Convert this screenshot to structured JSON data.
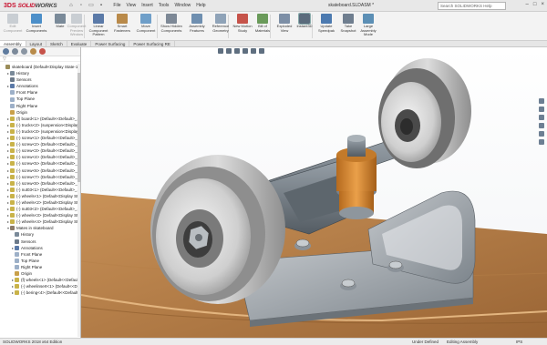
{
  "app": {
    "logo_prefix": "3DS",
    "logo_text_a": "SOLID",
    "logo_text_b": "WORKS",
    "document_title": "skateboard.SLDASM *",
    "search_placeholder": "Search SOLIDWORKS Help",
    "menu": [
      "File",
      "View",
      "Insert",
      "Tools",
      "Window",
      "Help"
    ]
  },
  "ribbon": {
    "buttons": [
      {
        "label": "Edit Component",
        "icon": "edit-component-icon",
        "dim": true
      },
      {
        "label": "Insert Components",
        "icon": "insert-components-icon"
      },
      {
        "label": "Mate",
        "icon": "mate-icon"
      },
      {
        "label": "Component Preview Window",
        "icon": "component-preview-icon",
        "dim": true
      },
      {
        "label": "Linear Component Pattern",
        "icon": "linear-pattern-icon"
      },
      {
        "label": "Smart Fasteners",
        "icon": "smart-fasteners-icon"
      },
      {
        "label": "Move Component",
        "icon": "move-component-icon"
      },
      {
        "label": "Show Hidden Components",
        "icon": "show-hidden-icon"
      },
      {
        "label": "Assembly Features",
        "icon": "assembly-features-icon"
      },
      {
        "label": "Reference Geometry",
        "icon": "reference-geometry-icon"
      },
      {
        "label": "New Motion Study",
        "icon": "motion-study-icon"
      },
      {
        "label": "Bill of Materials",
        "icon": "bom-icon"
      },
      {
        "label": "Exploded View",
        "icon": "exploded-view-icon"
      },
      {
        "label": "Instant3D",
        "icon": "instant3d-icon",
        "selected": true
      },
      {
        "label": "Update Speedpak",
        "icon": "speedpak-icon"
      },
      {
        "label": "Take Snapshot",
        "icon": "snapshot-icon"
      },
      {
        "label": "Large Assembly Mode",
        "icon": "large-assembly-icon"
      }
    ]
  },
  "tabs": [
    "Assembly",
    "Layout",
    "Sketch",
    "Evaluate",
    "Power Surfacing",
    "Power Surfacing RE"
  ],
  "tree": {
    "filter_icon": "filter-icon",
    "items": [
      {
        "label": "skateboard (Default<Display State-1>)",
        "indent": 0,
        "twisty": "",
        "icon": "#9b8d5a"
      },
      {
        "label": "History",
        "indent": 1,
        "twisty": "▸",
        "icon": "#7a8a99"
      },
      {
        "label": "Sensors",
        "indent": 1,
        "twisty": "",
        "icon": "#6c7a8a"
      },
      {
        "label": "Annotations",
        "indent": 1,
        "twisty": "▸",
        "icon": "#5b7aa8"
      },
      {
        "label": "Front Plane",
        "indent": 1,
        "twisty": "",
        "icon": "#9db0c8"
      },
      {
        "label": "Top Plane",
        "indent": 1,
        "twisty": "",
        "icon": "#9db0c8"
      },
      {
        "label": "Right Plane",
        "indent": 1,
        "twisty": "",
        "icon": "#9db0c8"
      },
      {
        "label": "Origin",
        "indent": 1,
        "twisty": "",
        "icon": "#c9a04a"
      },
      {
        "label": "(f) board<1> (Default<<Default>_...",
        "indent": 1,
        "twisty": "▸",
        "icon": "#c9b34a"
      },
      {
        "label": "(-) trucks<2> (suspension<Display...",
        "indent": 1,
        "twisty": "▸",
        "icon": "#c9b34a"
      },
      {
        "label": "(-) trucks<3> (suspension<Display...",
        "indent": 1,
        "twisty": "▸",
        "icon": "#c9b34a"
      },
      {
        "label": "(-) screw<1> (Default<<Default>_...",
        "indent": 1,
        "twisty": "▸",
        "icon": "#c9b34a"
      },
      {
        "label": "(-) screw<2> (Default<<Default>_...",
        "indent": 1,
        "twisty": "▸",
        "icon": "#c9b34a"
      },
      {
        "label": "(-) screw<3> (Default<<Default>_...",
        "indent": 1,
        "twisty": "▸",
        "icon": "#c9b34a"
      },
      {
        "label": "(-) screw<4> (Default<<Default>_...",
        "indent": 1,
        "twisty": "▸",
        "icon": "#c9b34a"
      },
      {
        "label": "(-) screw<5> (Default<<Default>_...",
        "indent": 1,
        "twisty": "▸",
        "icon": "#c9b34a"
      },
      {
        "label": "(-) screw<6> (Default<<Default>_...",
        "indent": 1,
        "twisty": "▸",
        "icon": "#c9b34a"
      },
      {
        "label": "(-) screw<7> (Default<<Default>_...",
        "indent": 1,
        "twisty": "▸",
        "icon": "#c9b34a"
      },
      {
        "label": "(-) screw<8> (Default<<Default>_...",
        "indent": 1,
        "twisty": "▸",
        "icon": "#c9b34a"
      },
      {
        "label": "(-) nut03<1> (Default<<Default>_...",
        "indent": 1,
        "twisty": "▸",
        "icon": "#c9b34a"
      },
      {
        "label": "(-) wheels<1> (Default<Display St...",
        "indent": 1,
        "twisty": "▸",
        "icon": "#c9b34a"
      },
      {
        "label": "(-) wheels<2> (Default<Display St...",
        "indent": 1,
        "twisty": "▸",
        "icon": "#c9b34a"
      },
      {
        "label": "(-) nut03<2> (Default<<Default>_...",
        "indent": 1,
        "twisty": "▸",
        "icon": "#c9b34a"
      },
      {
        "label": "(-) wheels<3> (Default<Display St...",
        "indent": 1,
        "twisty": "▸",
        "icon": "#c9b34a"
      },
      {
        "label": "(-) wheels<4> (Default<Display St...",
        "indent": 1,
        "twisty": "▸",
        "icon": "#c9b34a"
      },
      {
        "label": "Mates in skateboard",
        "indent": 1,
        "twisty": "▾",
        "icon": "#8a7a6a"
      },
      {
        "label": "History",
        "indent": 2,
        "twisty": "",
        "icon": "#7a8a99"
      },
      {
        "label": "Sensors",
        "indent": 2,
        "twisty": "",
        "icon": "#6c7a8a"
      },
      {
        "label": "Annotations",
        "indent": 2,
        "twisty": "▸",
        "icon": "#5b7aa8"
      },
      {
        "label": "Front Plane",
        "indent": 2,
        "twisty": "",
        "icon": "#9db0c8"
      },
      {
        "label": "Top Plane",
        "indent": 2,
        "twisty": "",
        "icon": "#9db0c8"
      },
      {
        "label": "Right Plane",
        "indent": 2,
        "twisty": "",
        "icon": "#9db0c8"
      },
      {
        "label": "Origin",
        "indent": 2,
        "twisty": "",
        "icon": "#c9a04a"
      },
      {
        "label": "(f) wheels<1> (Default<<Default>...",
        "indent": 2,
        "twisty": "▸",
        "icon": "#c9b34a"
      },
      {
        "label": "(-) wheelinsert<1> (Default<<D...",
        "indent": 2,
        "twisty": "▸",
        "icon": "#c9b34a"
      },
      {
        "label": "(-) bering<4> (Default<<Default...",
        "indent": 2,
        "twisty": "▸",
        "icon": "#c9b34a"
      }
    ]
  },
  "status": {
    "left": "SOLIDWORKS 2018 x64 Edition",
    "under_defined": "Under Defined",
    "mode": "Editing Assembly",
    "units": "IPS"
  },
  "colors": {
    "accent": "#c8102e",
    "wheel": "#cfcfcf",
    "hanger": "#6f7880",
    "bushing": "#d68a2b",
    "deck": "#b07a42"
  }
}
